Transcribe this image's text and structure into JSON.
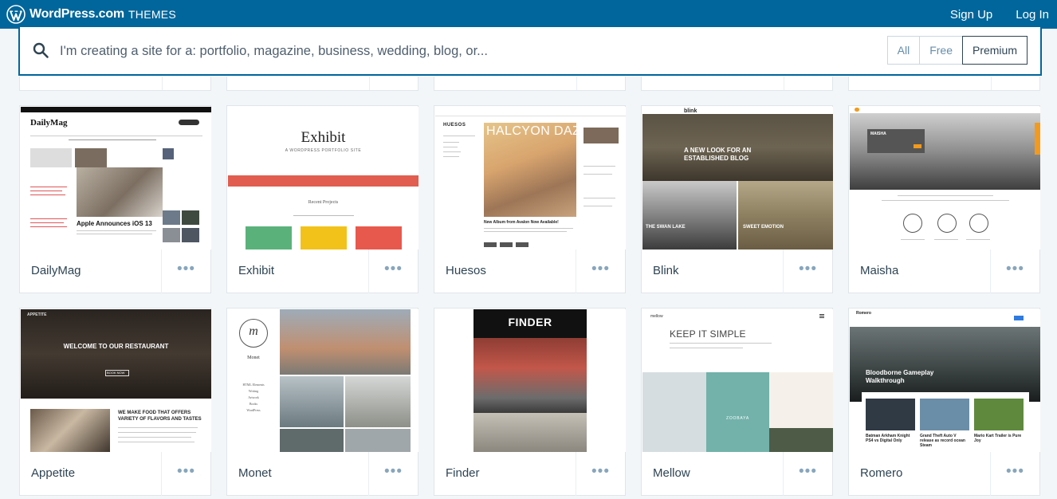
{
  "header": {
    "brand_name": "WordPress.com",
    "brand_sub": "THEMES",
    "sign_up": "Sign Up",
    "log_in": "Log In",
    "bar_color": "#00669b"
  },
  "search": {
    "placeholder": "I'm creating a site for a: portfolio, magazine, business, wedding, blog, or...",
    "filters": [
      "All",
      "Free",
      "Premium"
    ],
    "active_filter": "Premium"
  },
  "themes": [
    {
      "name": "DailyMag",
      "preview": {
        "logo": "DailyMag",
        "headline": "Apple Announces iOS 13"
      }
    },
    {
      "name": "Exhibit",
      "preview": {
        "title": "Exhibit",
        "tagline": "A WORDPRESS PORTFOLIO SITE",
        "section": "Recent Projects"
      }
    },
    {
      "name": "Huesos",
      "preview": {
        "logo": "HUESOS",
        "hero": "HALCYON DAZE",
        "caption": "New Album from Avalon Now Available!"
      }
    },
    {
      "name": "Blink",
      "preview": {
        "logo": "blink",
        "hero": "A NEW LOOK FOR AN ESTABLISHED BLOG",
        "left_caption": "THE SWAN LAKE",
        "right_caption": "SWEET EMOTION"
      }
    },
    {
      "name": "Maisha",
      "preview": {
        "logo": "MAISHA"
      }
    },
    {
      "name": "Appetite",
      "preview": {
        "logo": "APPETITE",
        "hero": "WELCOME TO OUR RESTAURANT",
        "cta": "BOOK NOW",
        "subhead": "WE MAKE FOOD THAT OFFERS VARIETY OF FLAVORS AND TASTES"
      }
    },
    {
      "name": "Monet",
      "preview": {
        "name": "Monet",
        "logo_letter": "m",
        "nav": [
          "HTML Elements",
          "Writing",
          "Artwork",
          "Books",
          "WordPress"
        ]
      }
    },
    {
      "name": "Finder",
      "preview": {
        "logo": "FINDER"
      }
    },
    {
      "name": "Mellow",
      "preview": {
        "logo": "mellow",
        "hero": "KEEP IT SIMPLE",
        "tile": "ZOOBAYA"
      }
    },
    {
      "name": "Romero",
      "preview": {
        "logo": "Romero",
        "hero": "Bloodborne Gameplay Walkthrough",
        "posts": [
          "Batman Arkham Knight PS4 vs Digital Only",
          "Grand Theft Auto V release as record ocean Steam",
          "Mario Kart Trailer is Pure Joy"
        ]
      }
    }
  ],
  "more_label": "•••"
}
